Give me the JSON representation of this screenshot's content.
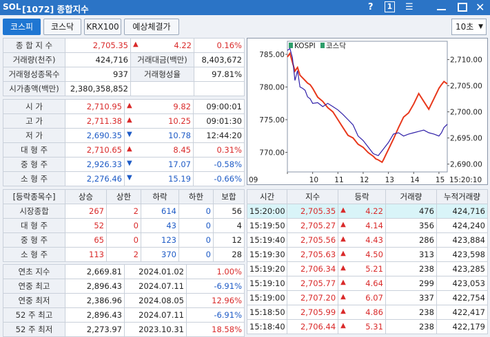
{
  "window": {
    "logo": "SOL",
    "title": "[1072] 종합지수",
    "help_icon": "?",
    "one_icon": "1"
  },
  "tabs": [
    "코스피",
    "코스닥",
    "KRX100",
    "예상체결가"
  ],
  "active_tab": 0,
  "interval_select": {
    "value": "10초"
  },
  "summary": {
    "rows": [
      {
        "label": "종 합 지 수",
        "value": "2,705.35",
        "dir": "up",
        "change": "4.22",
        "pct": "0.16%"
      },
      {
        "label": "거래량(천주)",
        "value": "424,716",
        "label2": "거래대금(백만)",
        "value2": "8,403,672"
      },
      {
        "label": "거래형성종목수",
        "value": "937",
        "label2": "거래형성율",
        "value2": "97.81%"
      },
      {
        "label": "시가총액(백만)",
        "value": "2,380,358,852"
      }
    ]
  },
  "ohlc": {
    "rows": [
      {
        "label": "시    가",
        "value": "2,710.95",
        "dir": "up",
        "change": "9.82",
        "extra": "09:00:01",
        "color": "red"
      },
      {
        "label": "고    가",
        "value": "2,711.38",
        "dir": "up",
        "change": "10.25",
        "extra": "09:01:30",
        "color": "red"
      },
      {
        "label": "저    가",
        "value": "2,690.35",
        "dir": "down",
        "change": "10.78",
        "extra": "12:44:20",
        "color": "blue"
      },
      {
        "label": "대 형 주",
        "value": "2,710.65",
        "dir": "up",
        "change": "8.45",
        "extra": "0.31%",
        "color": "red"
      },
      {
        "label": "중 형 주",
        "value": "2,926.33",
        "dir": "down",
        "change": "17.07",
        "extra": "-0.58%",
        "color": "blue"
      },
      {
        "label": "소 형 주",
        "value": "2,276.46",
        "dir": "down",
        "change": "15.19",
        "extra": "-0.66%",
        "color": "blue"
      }
    ]
  },
  "breadth": {
    "headers": [
      "[등락종목수]",
      "상승",
      "상한",
      "하락",
      "하한",
      "보합"
    ],
    "rows": [
      {
        "label": "시장종합",
        "vals": [
          "267",
          "2",
          "614",
          "0",
          "56"
        ]
      },
      {
        "label": "대 형 주",
        "vals": [
          "52",
          "0",
          "43",
          "0",
          "4"
        ]
      },
      {
        "label": "중 형 주",
        "vals": [
          "65",
          "0",
          "123",
          "0",
          "12"
        ]
      },
      {
        "label": "소 형 주",
        "vals": [
          "113",
          "2",
          "370",
          "0",
          "28"
        ]
      }
    ]
  },
  "yearly": {
    "rows": [
      {
        "label": "연초  지수",
        "value": "2,669.81",
        "date": "2024.01.02",
        "pct": "1.00%",
        "color": "red"
      },
      {
        "label": "연중  최고",
        "value": "2,896.43",
        "date": "2024.07.11",
        "pct": "-6.91%",
        "color": "blue"
      },
      {
        "label": "연중  최저",
        "value": "2,386.96",
        "date": "2024.08.05",
        "pct": "12.96%",
        "color": "red"
      },
      {
        "label": "52 주 최고",
        "value": "2,896.43",
        "date": "2024.07.11",
        "pct": "-6.91%",
        "color": "blue"
      },
      {
        "label": "52 주 최저",
        "value": "2,273.97",
        "date": "2023.10.31",
        "pct": "18.58%",
        "color": "red"
      }
    ]
  },
  "ticks": {
    "headers": [
      "시간",
      "지수",
      "등락",
      "거래량",
      "누적거래량"
    ],
    "rows": [
      {
        "time": "15:20:00",
        "index": "2,705.35",
        "change": "4.22",
        "vol": "476",
        "cum": "424,716"
      },
      {
        "time": "15:19:50",
        "index": "2,705.27",
        "change": "4.14",
        "vol": "356",
        "cum": "424,240"
      },
      {
        "time": "15:19:40",
        "index": "2,705.56",
        "change": "4.43",
        "vol": "286",
        "cum": "423,884"
      },
      {
        "time": "15:19:30",
        "index": "2,705.63",
        "change": "4.50",
        "vol": "313",
        "cum": "423,598"
      },
      {
        "time": "15:19:20",
        "index": "2,706.34",
        "change": "5.21",
        "vol": "238",
        "cum": "423,285"
      },
      {
        "time": "15:19:10",
        "index": "2,705.77",
        "change": "4.64",
        "vol": "299",
        "cum": "423,053"
      },
      {
        "time": "15:19:00",
        "index": "2,707.20",
        "change": "6.07",
        "vol": "337",
        "cum": "422,754"
      },
      {
        "time": "15:18:50",
        "index": "2,705.99",
        "change": "4.86",
        "vol": "238",
        "cum": "422,417"
      },
      {
        "time": "15:18:40",
        "index": "2,706.44",
        "change": "5.31",
        "vol": "238",
        "cum": "422,179"
      }
    ]
  },
  "colors": {
    "kospi": "#e8381c",
    "kosdaq": "#2f1fa8",
    "accent": "#2b74c6",
    "highlight": "#d9f4f8"
  },
  "chart_data": {
    "type": "line",
    "legend": [
      "KOSPI",
      "코스닥"
    ],
    "x_ticks": [
      "09",
      "10",
      "11",
      "12",
      "13",
      "14",
      "15",
      "15:20:10"
    ],
    "left_axis": {
      "ticks": [
        "785.00",
        "780.00",
        "775.00",
        "770.00"
      ],
      "ylim": [
        767,
        787
      ]
    },
    "right_axis": {
      "ticks": [
        "2,710.00",
        "2,705.00",
        "2,700.00",
        "2,695.00",
        "2,690.00"
      ],
      "ylim": [
        2688.5,
        2713.5
      ]
    },
    "series": [
      {
        "name": "KOSPI",
        "axis": "right",
        "x": [
          9.0,
          9.1,
          9.2,
          9.3,
          9.4,
          9.5,
          9.6,
          9.7,
          9.8,
          9.9,
          10.0,
          10.2,
          10.4,
          10.6,
          10.8,
          11.0,
          11.2,
          11.4,
          11.6,
          11.8,
          12.0,
          12.2,
          12.4,
          12.5,
          12.6,
          12.7,
          12.75,
          12.8,
          12.9,
          13.0,
          13.2,
          13.4,
          13.6,
          13.8,
          14.0,
          14.2,
          14.4,
          14.6,
          14.8,
          15.0,
          15.1,
          15.2,
          15.33
        ],
        "y": [
          2710.5,
          2711.2,
          2709.5,
          2707.8,
          2708.5,
          2707.0,
          2706.5,
          2706.0,
          2705.5,
          2705.2,
          2704.5,
          2702.8,
          2702.0,
          2700.8,
          2700.0,
          2698.5,
          2697.0,
          2695.5,
          2695.0,
          2693.8,
          2693.2,
          2692.2,
          2691.5,
          2691.0,
          2690.8,
          2690.5,
          2690.35,
          2690.8,
          2691.8,
          2692.8,
          2694.8,
          2697.0,
          2699.0,
          2699.8,
          2701.5,
          2703.5,
          2702.0,
          2700.5,
          2702.5,
          2704.5,
          2705.2,
          2705.8,
          2705.35
        ]
      },
      {
        "name": "코스닥",
        "axis": "left",
        "x": [
          9.0,
          9.1,
          9.2,
          9.3,
          9.4,
          9.5,
          9.6,
          9.7,
          9.8,
          9.9,
          10.0,
          10.2,
          10.4,
          10.6,
          10.8,
          11.0,
          11.2,
          11.4,
          11.6,
          11.8,
          12.0,
          12.2,
          12.4,
          12.6,
          12.8,
          13.0,
          13.2,
          13.4,
          13.6,
          13.8,
          14.0,
          14.2,
          14.4,
          14.6,
          14.8,
          15.0,
          15.1,
          15.2,
          15.33
        ],
        "y": [
          785.6,
          785.9,
          784.5,
          781.0,
          782.5,
          780.0,
          779.8,
          779.5,
          778.5,
          778.2,
          777.5,
          777.6,
          777.0,
          777.5,
          777.0,
          776.5,
          775.8,
          775.0,
          774.2,
          772.5,
          771.8,
          770.8,
          769.8,
          769.5,
          770.5,
          771.5,
          772.8,
          773.0,
          772.5,
          772.8,
          773.0,
          773.2,
          773.4,
          773.0,
          772.8,
          772.5,
          773.0,
          773.8,
          774.3
        ]
      }
    ]
  }
}
